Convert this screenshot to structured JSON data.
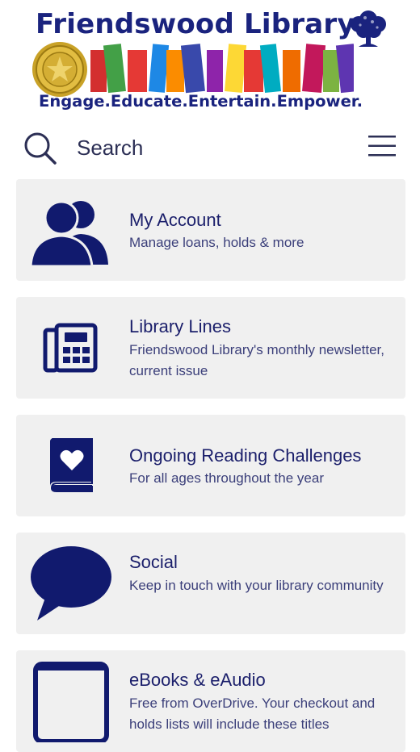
{
  "brand": {
    "title": "Friendswood Library",
    "tagline": "Engage.Educate.Entertain.Empower."
  },
  "colors": {
    "navy": "#1a237e",
    "icon": "#111a6e",
    "card_bg": "#f0f0f0",
    "books": [
      "#d32f2f",
      "#43a047",
      "#e53935",
      "#1e88e5",
      "#fb8c00",
      "#3949ab",
      "#8e24aa",
      "#fdd835",
      "#e53935",
      "#00acc1",
      "#ef6c00",
      "#c2185b",
      "#7cb342",
      "#5e35b1"
    ]
  },
  "search": {
    "label": "Search"
  },
  "menu": {
    "icon": "hamburger-menu-icon"
  },
  "cards": [
    {
      "icon": "account-users-icon",
      "title": "My Account",
      "description": "Manage loans, holds & more"
    },
    {
      "icon": "newsletter-fax-icon",
      "title": "Library Lines",
      "description": "Friendswood Library's monthly newsletter, current issue"
    },
    {
      "icon": "heart-book-icon",
      "title": "Ongoing Reading Challenges",
      "description": "For all ages throughout the year"
    },
    {
      "icon": "speech-bubble-icon",
      "title": "Social",
      "description": "Keep in touch with your library community"
    },
    {
      "icon": "tablet-icon",
      "title": "eBooks & eAudio",
      "description": "Free from OverDrive. Your checkout and holds lists will include these titles"
    }
  ]
}
